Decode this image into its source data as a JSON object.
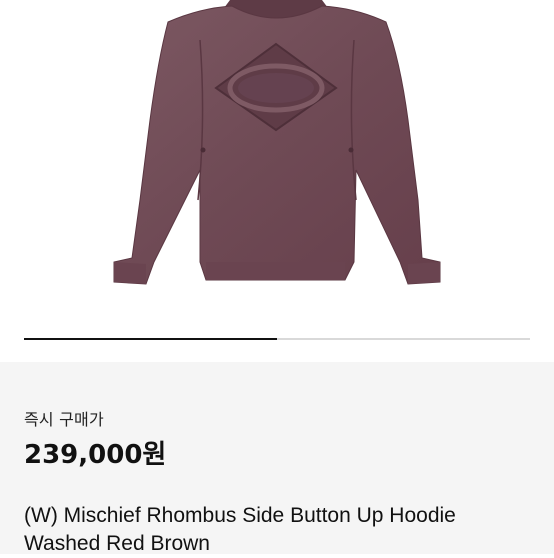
{
  "product": {
    "image_alt": "hoodie-product-image",
    "image_slider": {
      "current": 1,
      "total": 2,
      "progress": 0.5
    },
    "price_label": "즉시 구매가",
    "price": "239,000원",
    "title": "(W) Mischief Rhombus Side Button Up Hoodie Washed Red Brown",
    "garment_color": "#74505a",
    "accent_color": "#111111"
  }
}
